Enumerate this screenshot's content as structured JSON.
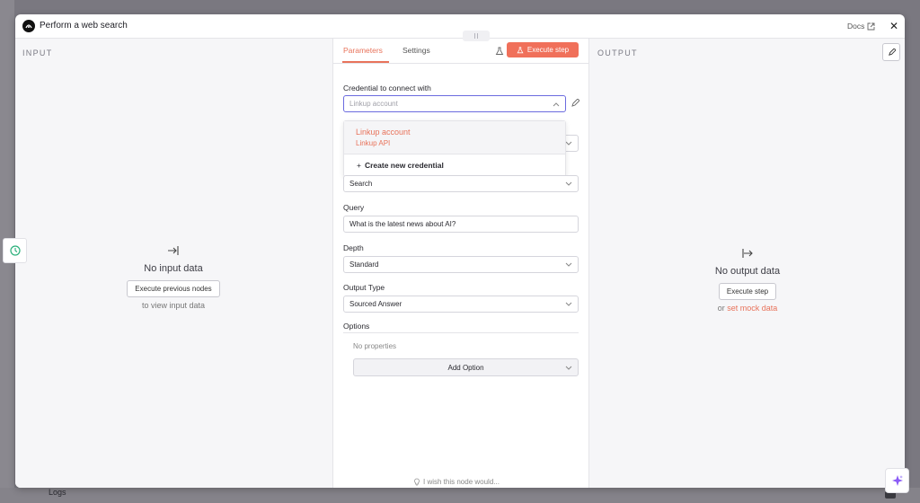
{
  "background": {
    "logs_label": "Logs"
  },
  "modal": {
    "title": "Perform a web search",
    "docs_label": "Docs",
    "close_label": "✕"
  },
  "input_panel": {
    "label": "INPUT",
    "empty_title": "No input data",
    "button_label": "Execute previous nodes",
    "subtext": "to view input data"
  },
  "output_panel": {
    "label": "OUTPUT",
    "empty_title": "No output data",
    "button_label": "Execute step",
    "sub_prefix": "or",
    "sub_link": "set mock data"
  },
  "center": {
    "tabs": [
      {
        "label": "Parameters",
        "active": true
      },
      {
        "label": "Settings",
        "active": false
      }
    ],
    "execute_label": "Execute step",
    "credential": {
      "label": "Credential to connect with",
      "placeholder": "Linkup account"
    },
    "dropdown": {
      "selected_name": "Linkup account",
      "selected_sub": "Linkup API",
      "create_label": "Create new credential"
    },
    "operation": {
      "value": "Search"
    },
    "query": {
      "label": "Query",
      "value": "What is the latest news about AI?"
    },
    "depth": {
      "label": "Depth",
      "value": "Standard"
    },
    "output_type": {
      "label": "Output Type",
      "value": "Sourced Answer"
    },
    "options": {
      "label": "Options",
      "no_properties": "No properties",
      "add_label": "Add Option"
    },
    "wish_label": "I wish this node would..."
  },
  "colors": {
    "accent": "#f0705a",
    "focus": "#6b6bdf"
  }
}
